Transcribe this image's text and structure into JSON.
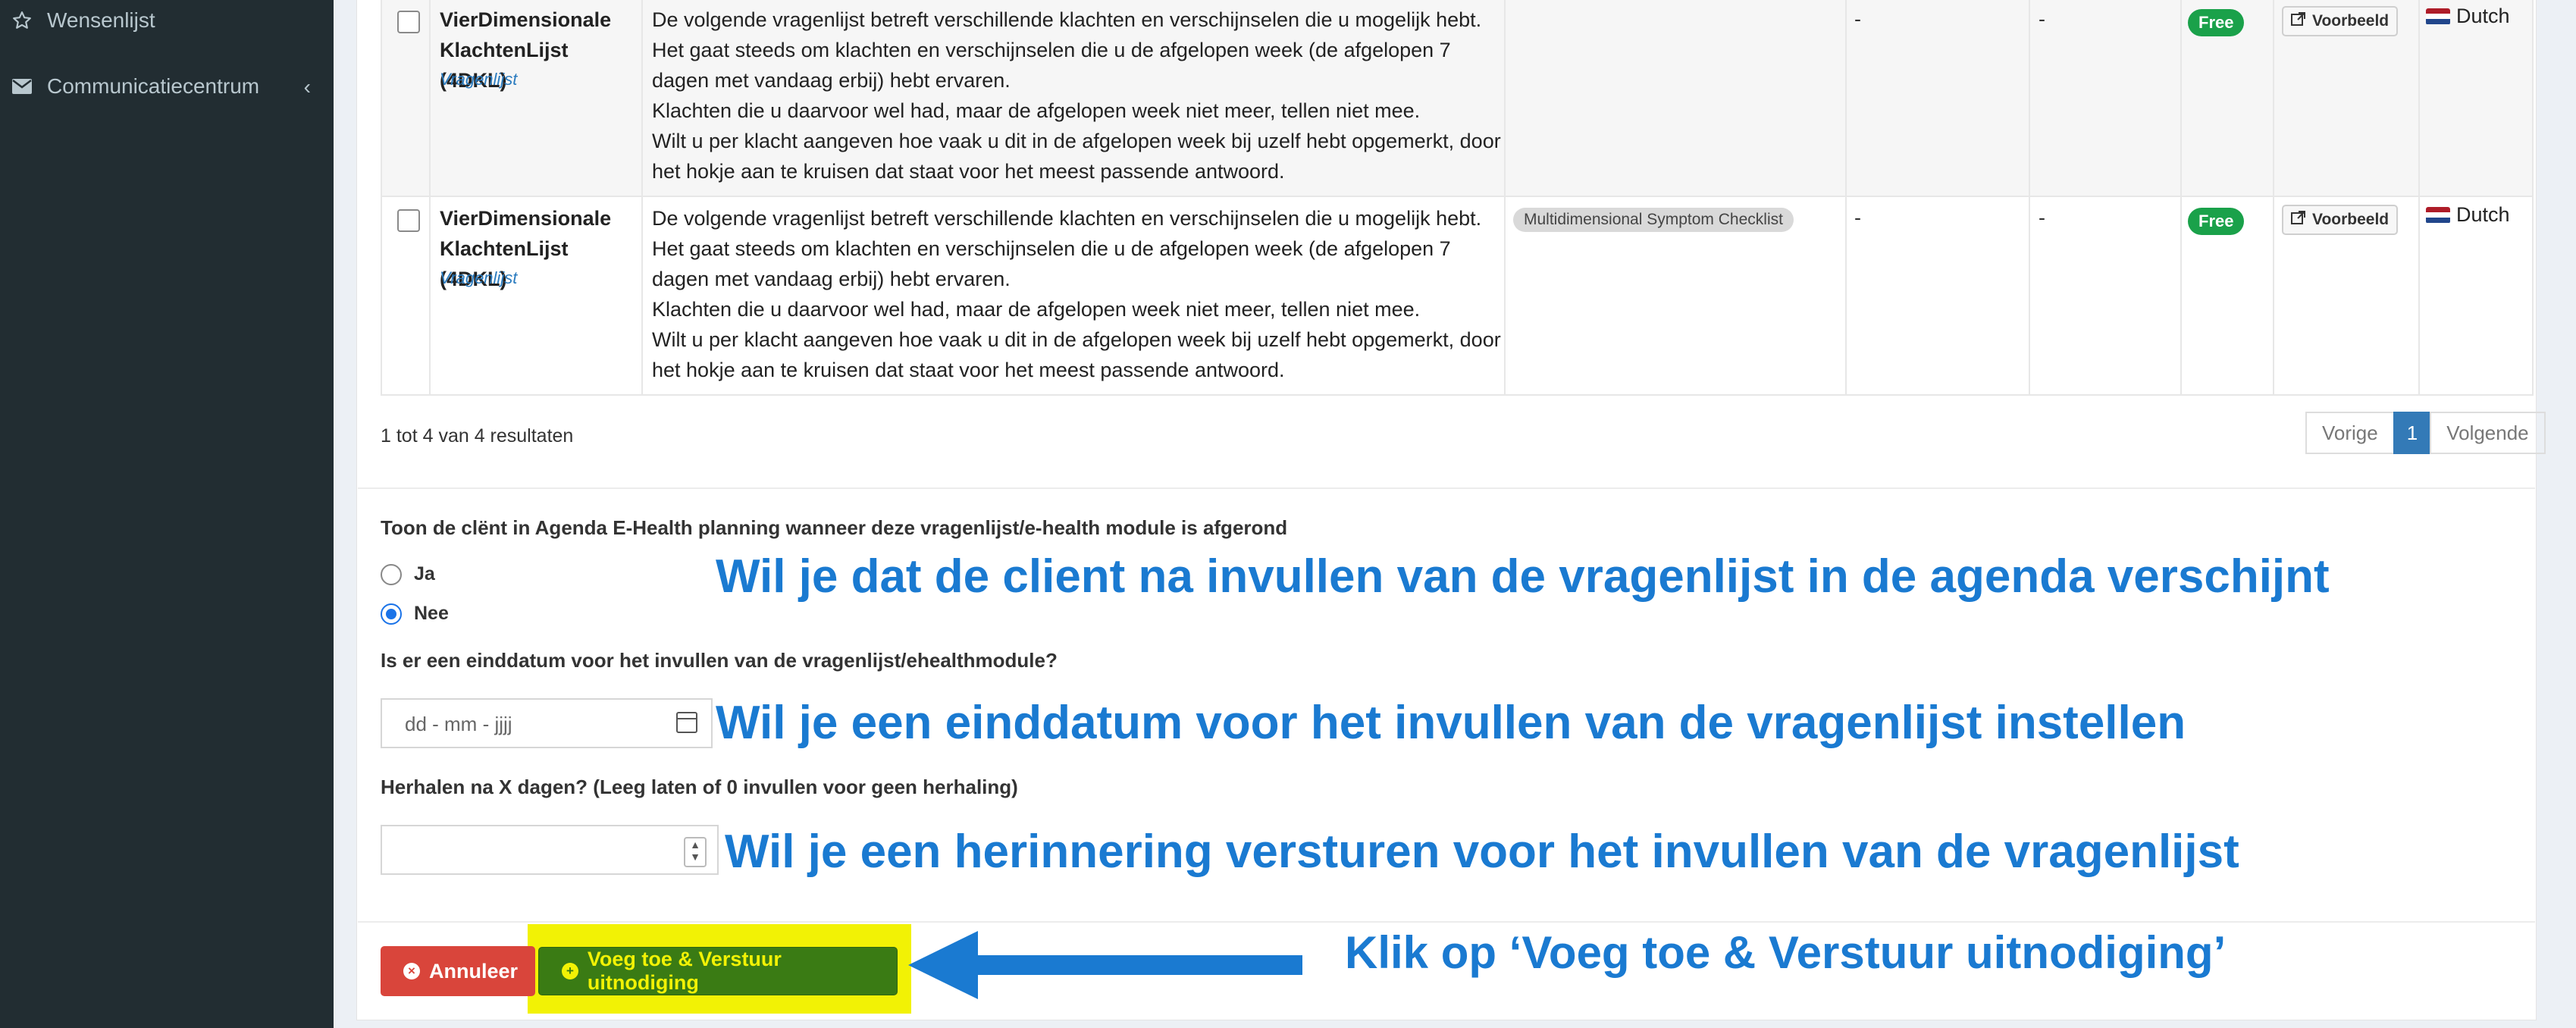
{
  "sidebar": {
    "items": [
      {
        "label": "Wensenlijst",
        "icon": "star-icon"
      },
      {
        "label": "Communicatiecentrum",
        "icon": "envelope-icon"
      }
    ]
  },
  "table": {
    "rows": [
      {
        "title": "VierDimensionale KlachtenLijst (4DKL)",
        "type": "Vragenlijst",
        "description": [
          "De volgende vragenlijst betreft verschillende klachten en verschijnselen die u mogelijk hebt.",
          "Het gaat steeds om klachten en verschijnselen die u de afgelopen week (de afgelopen 7 dagen met vandaag erbij) hebt ervaren.",
          "Klachten die u daarvoor wel had, maar de afgelopen week niet meer, tellen niet mee.",
          "Wilt u per klacht aangeven hoe vaak u dit in de afgelopen week bij uzelf hebt opgemerkt, door het hokje aan te kruisen dat staat voor het meest passende antwoord."
        ],
        "tag": "",
        "col_a": "-",
        "col_b": "-",
        "price": "Free",
        "preview": "Voorbeeld",
        "language": "Dutch"
      },
      {
        "title": "VierDimensionale KlachtenLijst (4DKL)",
        "type": "Vragenlijst",
        "description": [
          "De volgende vragenlijst betreft verschillende klachten en verschijnselen die u mogelijk hebt.",
          "Het gaat steeds om klachten en verschijnselen die u de afgelopen week (de afgelopen 7 dagen met vandaag erbij) hebt ervaren.",
          "Klachten die u daarvoor wel had, maar de afgelopen week niet meer, tellen niet mee.",
          "Wilt u per klacht aangeven hoe vaak u dit in de afgelopen week bij uzelf hebt opgemerkt, door het hokje aan te kruisen dat staat voor het meest passende antwoord."
        ],
        "tag": "Multidimensional Symptom Checklist",
        "col_a": "-",
        "col_b": "-",
        "price": "Free",
        "preview": "Voorbeeld",
        "language": "Dutch"
      }
    ],
    "results_text": "1 tot 4 van 4 resultaten",
    "pagination": {
      "prev": "Vorige",
      "current": "1",
      "next": "Volgende"
    }
  },
  "form": {
    "agenda_label": "Toon de clënt in Agenda E-Health planning wanneer deze vragenlijst/e-health module is afgerond",
    "options": [
      {
        "label": "Ja",
        "selected": false
      },
      {
        "label": "Nee",
        "selected": true
      }
    ],
    "enddate_label": "Is er een einddatum voor het invullen van de vragenlijst/ehealthmodule?",
    "enddate_placeholder": "dd - mm - jjjj",
    "repeat_label": "Herhalen na X dagen? (Leeg laten of 0 invullen voor geen herhaling)",
    "repeat_value": ""
  },
  "buttons": {
    "cancel": "Annuleer",
    "submit": "Voeg toe & Verstuur uitnodiging"
  },
  "annotations": {
    "agenda": "Wil je dat de client na invullen van de vragenlijst in de agenda verschijnt",
    "enddate": "Wil je een einddatum voor het invullen van de vragenlijst instellen",
    "reminder": "Wil je een herinnering versturen voor het invullen van de vragenlijst",
    "click": "Klik op ‘Voeg toe & Verstuur uitnodiging’"
  },
  "colors": {
    "annotation": "#1a7ad1",
    "highlight": "#f2f205",
    "submit_bg": "#3a7b14",
    "cancel_bg": "#d9453b",
    "free_badge": "#1aa14a",
    "sidebar_bg": "#222d32"
  }
}
